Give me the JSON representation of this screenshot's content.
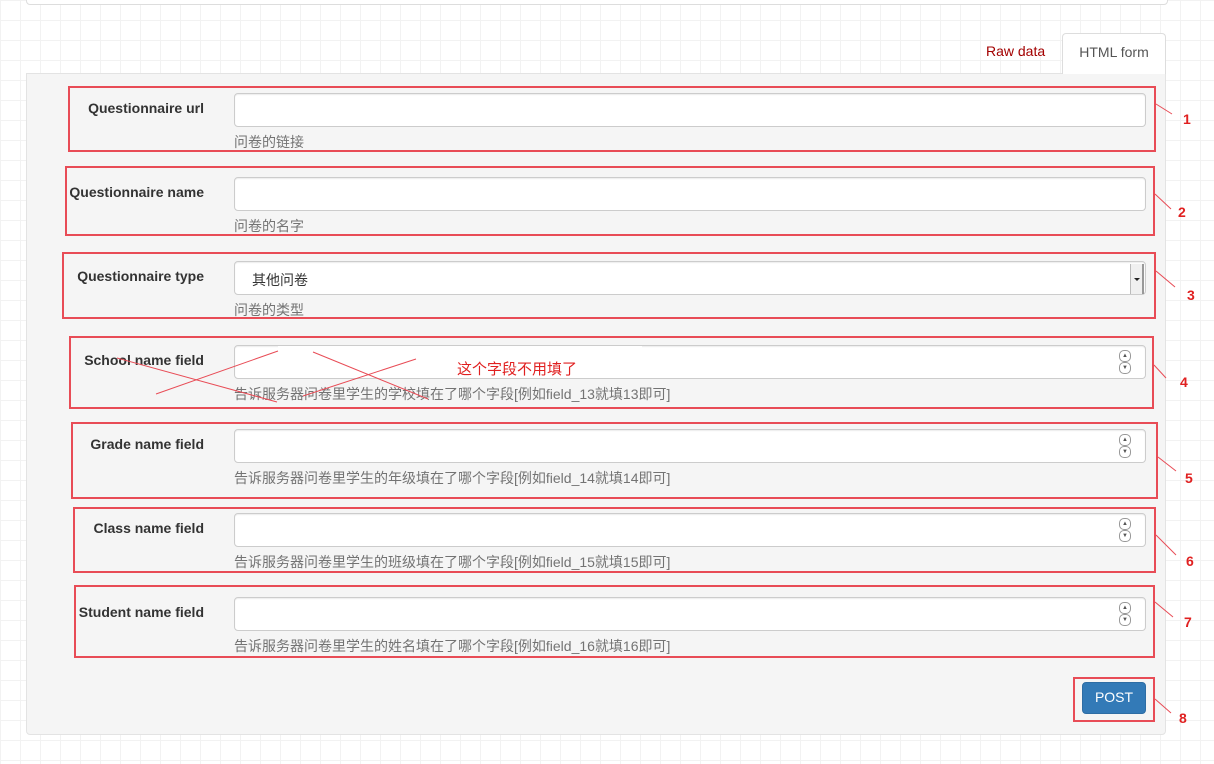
{
  "tabs": {
    "raw_label": "Raw data",
    "html_label": "HTML form"
  },
  "form": {
    "fields": [
      {
        "label": "Questionnaire url",
        "value": "",
        "help": "问卷的链接"
      },
      {
        "label": "Questionnaire name",
        "value": "",
        "help": "问卷的名字"
      },
      {
        "label": "Questionnaire type",
        "selected": "其他问卷",
        "help": "问卷的类型"
      },
      {
        "label": "School name field",
        "value": "",
        "help": "告诉服务器问卷里学生的学校填在了哪个字段[例如field_13就填13即可]"
      },
      {
        "label": "Grade name field",
        "value": "",
        "help": "告诉服务器问卷里学生的年级填在了哪个字段[例如field_14就填14即可]"
      },
      {
        "label": "Class name field",
        "value": "",
        "help": "告诉服务器问卷里学生的班级填在了哪个字段[例如field_15就填15即可]"
      },
      {
        "label": "Student name field",
        "value": "",
        "help": "告诉服务器问卷里学生的姓名填在了哪个字段[例如field_16就填16即可]"
      }
    ],
    "post_label": "POST"
  },
  "annotations": {
    "markers": [
      "1",
      "2",
      "3",
      "4",
      "5",
      "6",
      "7",
      "8"
    ],
    "note": "这个字段不用填了",
    "color": "#e02020"
  },
  "colors": {
    "primary_button": "#337ab7",
    "tab_link": "#a30000",
    "annotation": "#e84c56"
  }
}
